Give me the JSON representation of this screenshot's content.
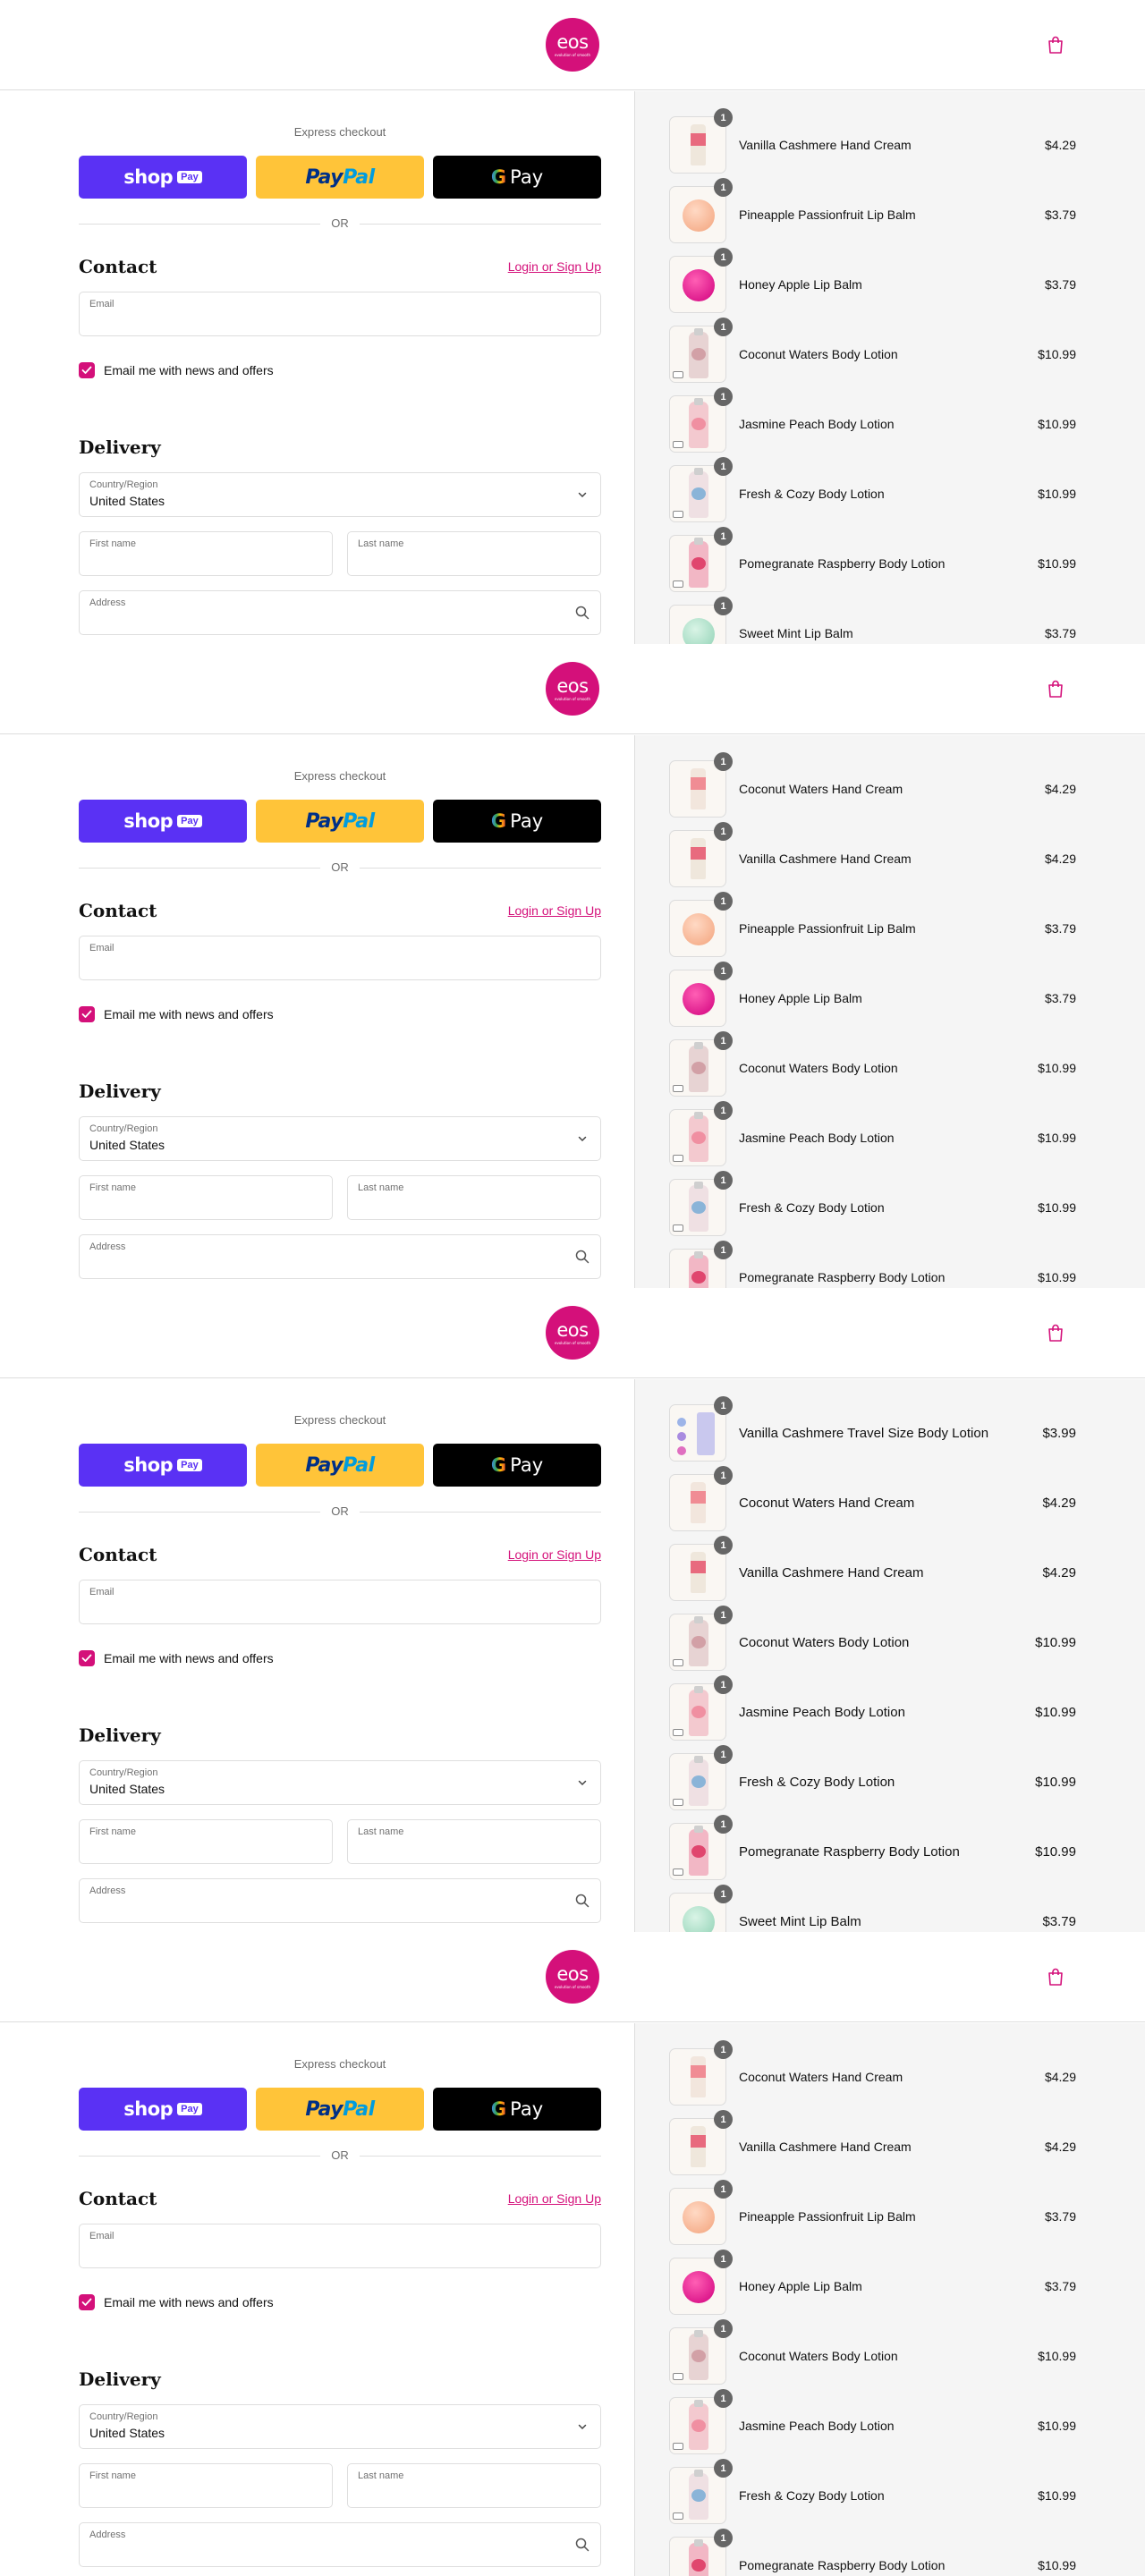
{
  "brand": {
    "logo_text": "eos",
    "tagline": "evolution of smooth",
    "accent_color": "#d4107a",
    "bag_icon": "shopping-bag-icon"
  },
  "checkout": {
    "express_label": "Express checkout",
    "shop_pay": {
      "shop": "shop",
      "pay": "Pay"
    },
    "paypal": {
      "pay": "Pay",
      "pal": "Pal"
    },
    "google_pay": {
      "g": "G",
      "pay": "Pay"
    },
    "or_label": "OR",
    "contact_heading": "Contact",
    "login_link": "Login or Sign Up",
    "email_label": "Email",
    "email_value": "",
    "newsletter_label": "Email me with news and offers",
    "newsletter_checked": true,
    "delivery_heading": "Delivery",
    "country_label": "Country/Region",
    "country_value": "United States",
    "first_name_label": "First name",
    "last_name_label": "Last name",
    "address_label": "Address"
  },
  "panels": [
    {
      "items": [
        {
          "qty": "1",
          "name": "Vanilla Cashmere Hand Cream",
          "price": "$4.29",
          "thumb": "tube-vanilla"
        },
        {
          "qty": "1",
          "name": "Pineapple Passionfruit Lip Balm",
          "price": "$3.79",
          "thumb": "sphere-peach"
        },
        {
          "qty": "1",
          "name": "Honey Apple Lip Balm",
          "price": "$3.79",
          "thumb": "sphere-magenta"
        },
        {
          "qty": "1",
          "name": "Coconut Waters Body Lotion",
          "price": "$10.99",
          "thumb": "bottle-coconut"
        },
        {
          "qty": "1",
          "name": "Jasmine Peach Body Lotion",
          "price": "$10.99",
          "thumb": "bottle-jasmine"
        },
        {
          "qty": "1",
          "name": "Fresh & Cozy Body Lotion",
          "price": "$10.99",
          "thumb": "bottle-fresh"
        },
        {
          "qty": "1",
          "name": "Pomegranate Raspberry Body Lotion",
          "price": "$10.99",
          "thumb": "bottle-pomegranate"
        },
        {
          "qty": "1",
          "name": "Sweet Mint Lip Balm",
          "price": "$3.79",
          "thumb": "sphere-mint"
        }
      ]
    },
    {
      "items": [
        {
          "qty": "1",
          "name": "Coconut Waters Hand Cream",
          "price": "$4.29",
          "thumb": "tube-coconut"
        },
        {
          "qty": "1",
          "name": "Vanilla Cashmere Hand Cream",
          "price": "$4.29",
          "thumb": "tube-vanilla"
        },
        {
          "qty": "1",
          "name": "Pineapple Passionfruit Lip Balm",
          "price": "$3.79",
          "thumb": "sphere-peach"
        },
        {
          "qty": "1",
          "name": "Honey Apple Lip Balm",
          "price": "$3.79",
          "thumb": "sphere-magenta"
        },
        {
          "qty": "1",
          "name": "Coconut Waters Body Lotion",
          "price": "$10.99",
          "thumb": "bottle-coconut"
        },
        {
          "qty": "1",
          "name": "Jasmine Peach Body Lotion",
          "price": "$10.99",
          "thumb": "bottle-jasmine"
        },
        {
          "qty": "1",
          "name": "Fresh & Cozy Body Lotion",
          "price": "$10.99",
          "thumb": "bottle-fresh"
        },
        {
          "qty": "1",
          "name": "Pomegranate Raspberry Body Lotion",
          "price": "$10.99",
          "thumb": "bottle-pomegranate"
        }
      ]
    },
    {
      "items": [
        {
          "qty": "1",
          "name": "Vanilla Cashmere Travel Size Body Lotion",
          "price": "$3.99",
          "thumb": "travel-vanilla"
        },
        {
          "qty": "1",
          "name": "Coconut Waters Hand Cream",
          "price": "$4.29",
          "thumb": "tube-coconut"
        },
        {
          "qty": "1",
          "name": "Vanilla Cashmere Hand Cream",
          "price": "$4.29",
          "thumb": "tube-vanilla"
        },
        {
          "qty": "1",
          "name": "Coconut Waters Body Lotion",
          "price": "$10.99",
          "thumb": "bottle-coconut"
        },
        {
          "qty": "1",
          "name": "Jasmine Peach Body Lotion",
          "price": "$10.99",
          "thumb": "bottle-jasmine"
        },
        {
          "qty": "1",
          "name": "Fresh & Cozy Body Lotion",
          "price": "$10.99",
          "thumb": "bottle-fresh"
        },
        {
          "qty": "1",
          "name": "Pomegranate Raspberry Body Lotion",
          "price": "$10.99",
          "thumb": "bottle-pomegranate"
        },
        {
          "qty": "1",
          "name": "Sweet Mint Lip Balm",
          "price": "$3.79",
          "thumb": "sphere-mint"
        }
      ]
    },
    {
      "items": [
        {
          "qty": "1",
          "name": "Coconut Waters Hand Cream",
          "price": "$4.29",
          "thumb": "tube-coconut"
        },
        {
          "qty": "1",
          "name": "Vanilla Cashmere Hand Cream",
          "price": "$4.29",
          "thumb": "tube-vanilla"
        },
        {
          "qty": "1",
          "name": "Pineapple Passionfruit Lip Balm",
          "price": "$3.79",
          "thumb": "sphere-peach"
        },
        {
          "qty": "1",
          "name": "Honey Apple Lip Balm",
          "price": "$3.79",
          "thumb": "sphere-magenta"
        },
        {
          "qty": "1",
          "name": "Coconut Waters Body Lotion",
          "price": "$10.99",
          "thumb": "bottle-coconut"
        },
        {
          "qty": "1",
          "name": "Jasmine Peach Body Lotion",
          "price": "$10.99",
          "thumb": "bottle-jasmine"
        },
        {
          "qty": "1",
          "name": "Fresh & Cozy Body Lotion",
          "price": "$10.99",
          "thumb": "bottle-fresh"
        },
        {
          "qty": "1",
          "name": "Pomegranate Raspberry Body Lotion",
          "price": "$10.99",
          "thumb": "bottle-pomegranate"
        }
      ]
    }
  ],
  "colors": {
    "shop_pay": "#5a31f4",
    "paypal": "#ffc439",
    "google_pay": "#000000",
    "sidebar_bg": "#f5f5f5",
    "qty_badge": "#666666"
  }
}
